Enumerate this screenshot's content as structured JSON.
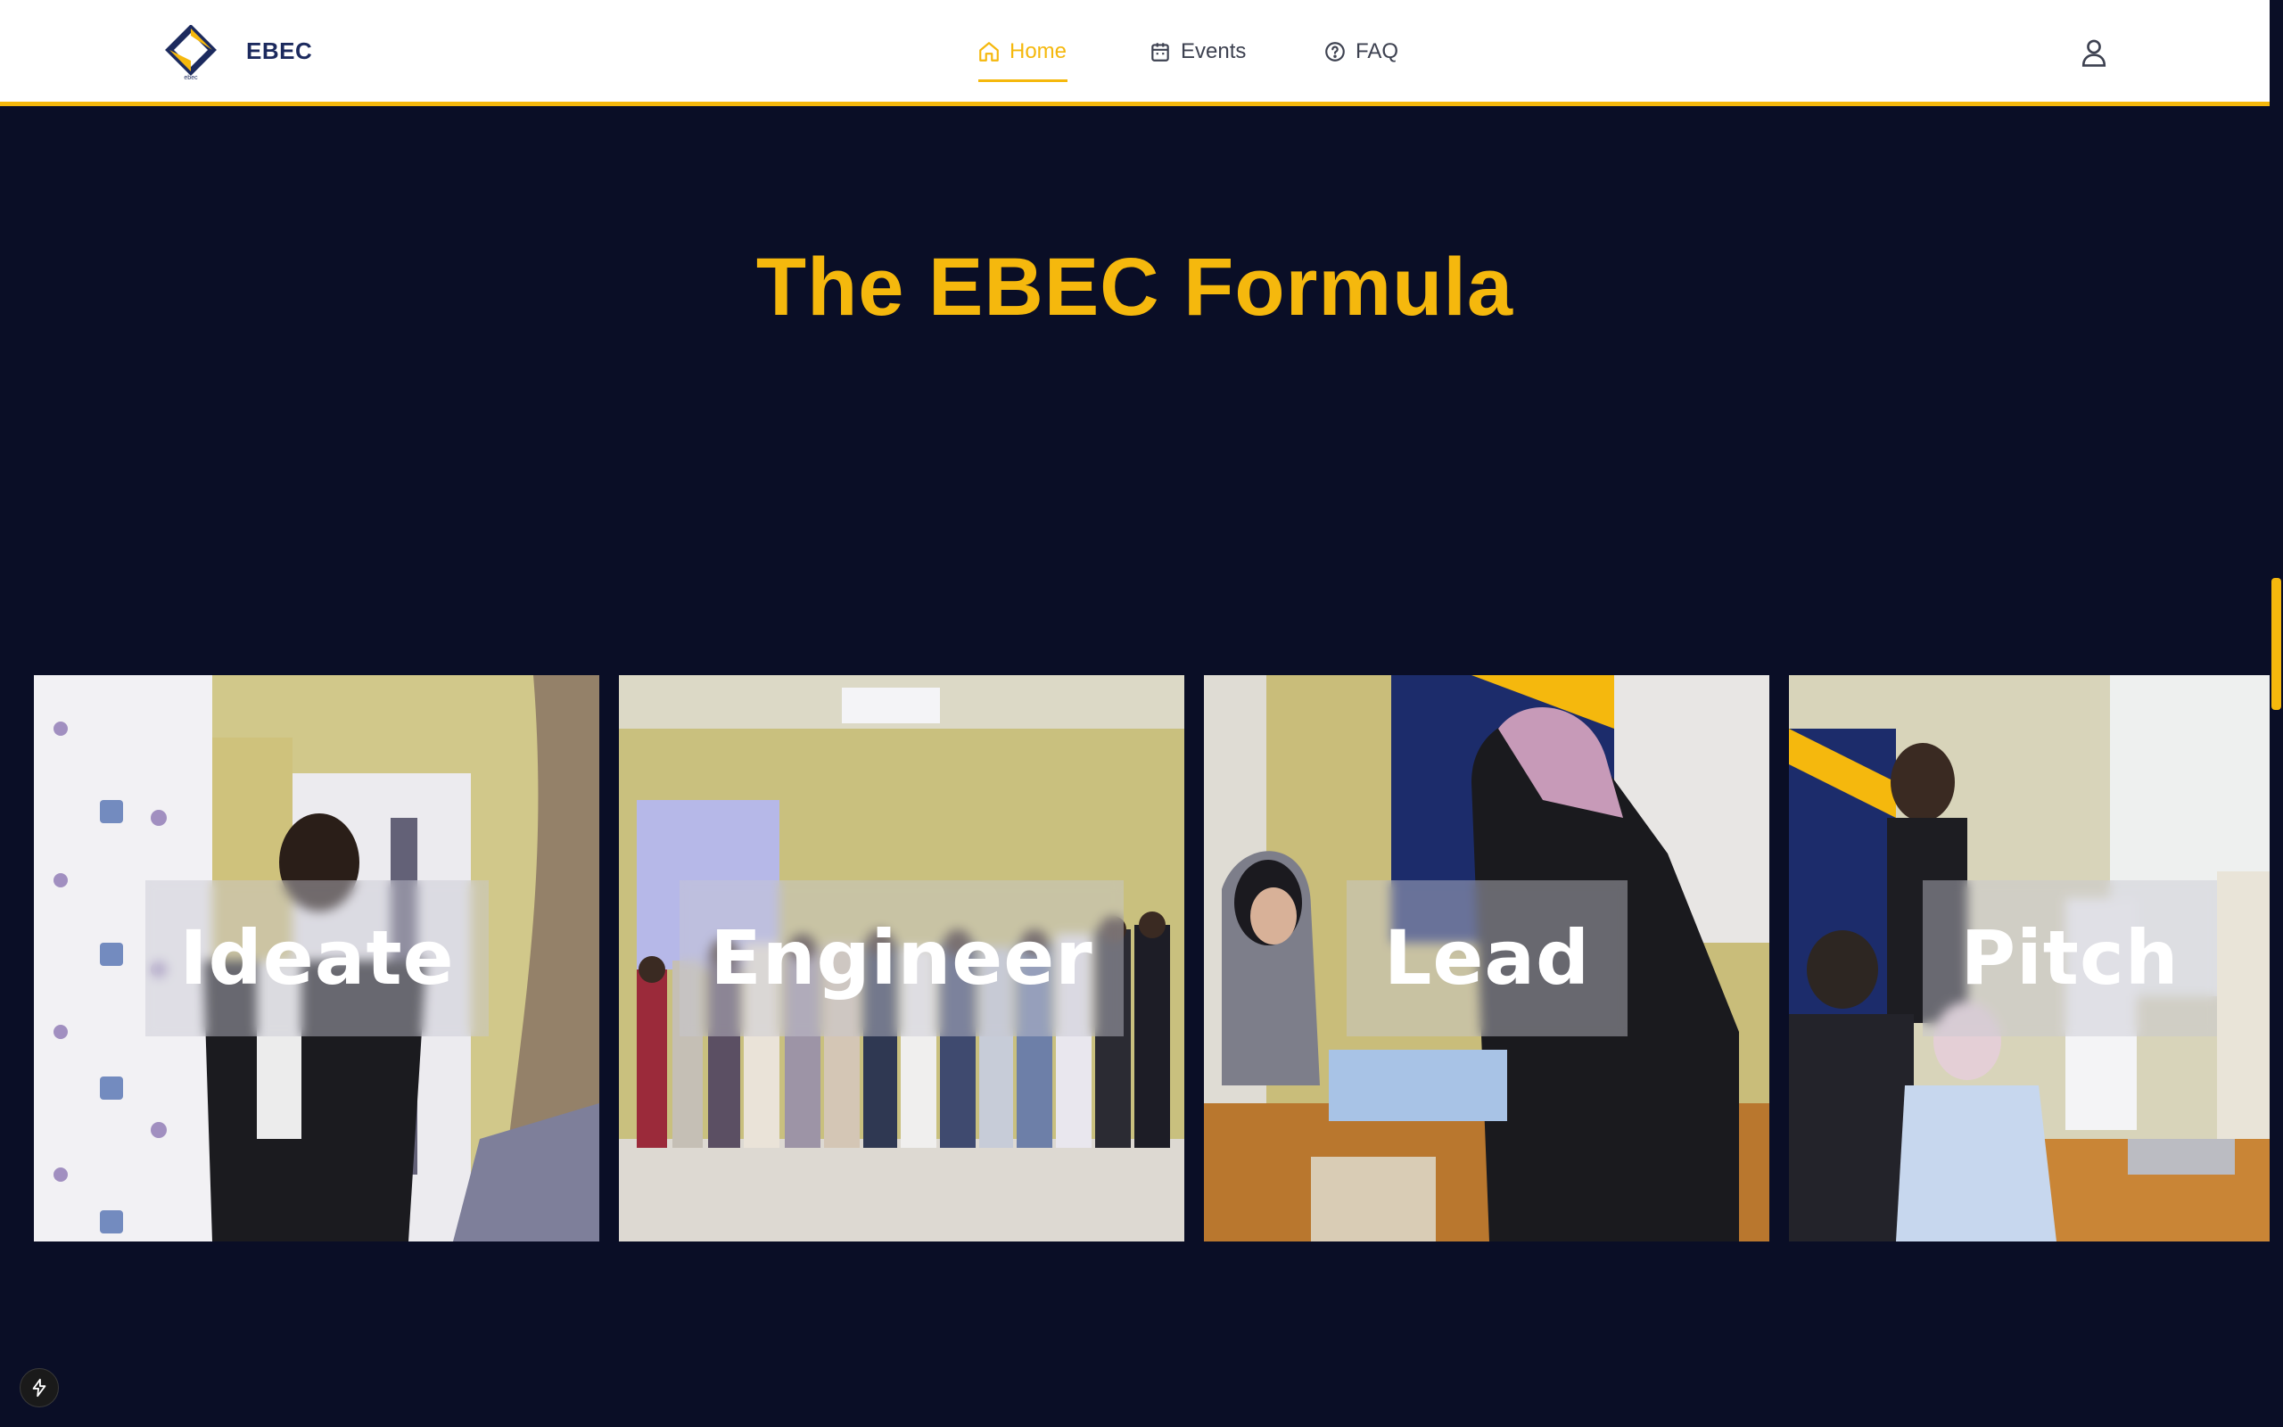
{
  "header": {
    "brand": "EBEC",
    "nav": [
      {
        "label": "Home",
        "icon": "home-icon",
        "active": true
      },
      {
        "label": "Events",
        "icon": "calendar-icon",
        "active": false
      },
      {
        "label": "FAQ",
        "icon": "help-circle-icon",
        "active": false
      }
    ],
    "user_icon": "user-icon"
  },
  "section": {
    "title": "The EBEC Formula"
  },
  "cards": [
    {
      "label": "Ideate"
    },
    {
      "label": "Engineer"
    },
    {
      "label": "Lead"
    },
    {
      "label": "Pitch"
    }
  ],
  "colors": {
    "accent": "#f5b80d",
    "background": "#0a0e26",
    "brand_text": "#1c2a5e"
  }
}
